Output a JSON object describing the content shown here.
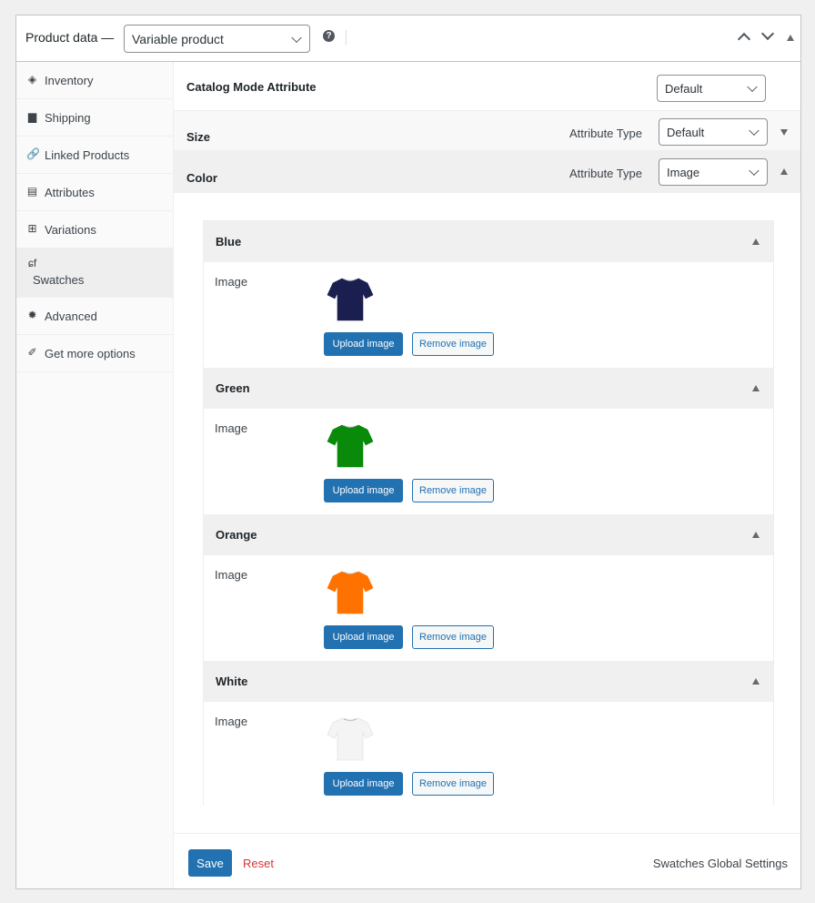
{
  "header": {
    "title": "Product data —",
    "product_type": "Variable product",
    "help_icon": "question-circle-icon",
    "move_up_icon": "chevron-up-icon",
    "move_down_icon": "chevron-down-icon",
    "toggle_icon": "triangle-up-icon"
  },
  "sidebar": {
    "items": [
      {
        "label": "Inventory",
        "icon": "tag-icon",
        "glyph": "◈"
      },
      {
        "label": "Shipping",
        "icon": "truck-icon",
        "glyph": "▆"
      },
      {
        "label": "Linked Products",
        "icon": "link-icon",
        "glyph": "🔗"
      },
      {
        "label": "Attributes",
        "icon": "list-card-icon",
        "glyph": "▤"
      },
      {
        "label": "Variations",
        "icon": "grid-icon",
        "glyph": "⊞"
      },
      {
        "label": "Swatches",
        "icon": "swatches-logo-icon",
        "glyph": "ɕf",
        "active": true
      },
      {
        "label": "Advanced",
        "icon": "gear-icon",
        "glyph": "✹"
      },
      {
        "label": "Get more options",
        "icon": "plugin-icon",
        "glyph": "✐"
      }
    ]
  },
  "main": {
    "catalog": {
      "label": "Catalog Mode Attribute",
      "value": "Default"
    },
    "attributes": [
      {
        "name": "Size",
        "type_label": "Attribute Type",
        "type_value": "Default",
        "expanded": false
      },
      {
        "name": "Color",
        "type_label": "Attribute Type",
        "type_value": "Image",
        "expanded": true
      }
    ],
    "swatches": [
      {
        "name": "Blue",
        "field_label": "Image",
        "color": "#1b1f4f",
        "upload": "Upload image",
        "remove": "Remove image"
      },
      {
        "name": "Green",
        "field_label": "Image",
        "color": "#0a8a0a",
        "upload": "Upload image",
        "remove": "Remove image"
      },
      {
        "name": "Orange",
        "field_label": "Image",
        "color": "#ff7200",
        "upload": "Upload image",
        "remove": "Remove image"
      },
      {
        "name": "White",
        "field_label": "Image",
        "color": "#f4f4f4",
        "upload": "Upload image",
        "remove": "Remove image"
      }
    ],
    "footer": {
      "save": "Save",
      "reset": "Reset",
      "global_settings": "Swatches Global Settings"
    }
  },
  "colors": {
    "primary": "#2271b1",
    "danger": "#d63638",
    "panel_bg": "#f0f0f1"
  }
}
